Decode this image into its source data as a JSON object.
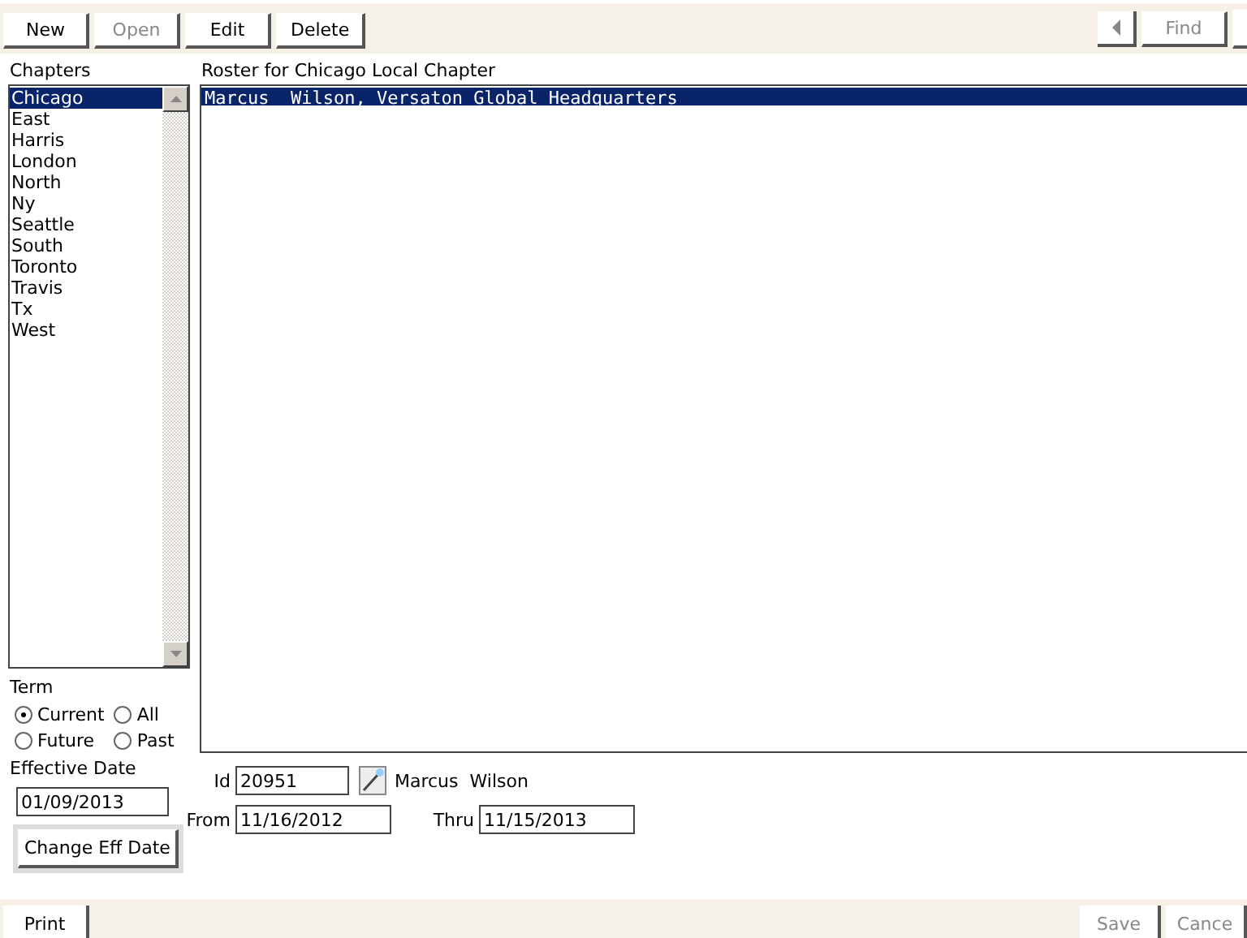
{
  "toolbar": {
    "left": [
      {
        "label": "New",
        "disabled": false
      },
      {
        "label": "Open",
        "disabled": true
      },
      {
        "label": "Edit",
        "disabled": false
      },
      {
        "label": "Delete",
        "disabled": false
      }
    ],
    "right": [
      {
        "label": "Find",
        "disabled": true
      }
    ]
  },
  "chapters": {
    "label": "Chapters",
    "items": [
      {
        "label": "Chicago",
        "selected": true
      },
      {
        "label": "East",
        "selected": false
      },
      {
        "label": "Harris",
        "selected": false
      },
      {
        "label": "London",
        "selected": false
      },
      {
        "label": "North",
        "selected": false
      },
      {
        "label": "Ny",
        "selected": false
      },
      {
        "label": "Seattle",
        "selected": false
      },
      {
        "label": "South",
        "selected": false
      },
      {
        "label": "Toronto",
        "selected": false
      },
      {
        "label": "Travis",
        "selected": false
      },
      {
        "label": "Tx",
        "selected": false
      },
      {
        "label": "West",
        "selected": false
      }
    ]
  },
  "roster": {
    "label": "Roster for Chicago Local Chapter",
    "rows": [
      {
        "text": "Marcus  Wilson, Versaton Global Headquarters",
        "selected": true
      }
    ]
  },
  "term": {
    "label": "Term",
    "options": [
      {
        "label": "Current",
        "selected": true
      },
      {
        "label": "All",
        "selected": false
      },
      {
        "label": "Future",
        "selected": false
      },
      {
        "label": "Past",
        "selected": false
      }
    ]
  },
  "effective_date": {
    "label": "Effective Date",
    "value": "01/09/2013",
    "button": "Change Eff Date"
  },
  "member": {
    "id_label": "Id",
    "id": "20951",
    "name": "Marcus  Wilson",
    "from_label": "From",
    "from": "11/16/2012",
    "thru_label": "Thru",
    "thru": "11/15/2013"
  },
  "bottom_bar": {
    "left": [
      {
        "label": "Print",
        "disabled": false
      }
    ],
    "right": [
      {
        "label": "Save",
        "disabled": true
      },
      {
        "label": "Cance",
        "disabled": true
      }
    ]
  }
}
